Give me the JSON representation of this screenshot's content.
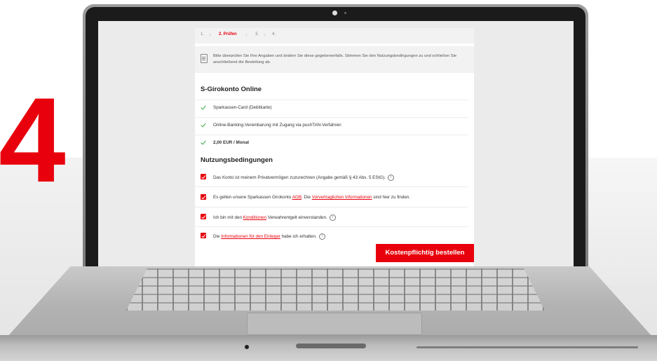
{
  "hero": {
    "step_number": "4"
  },
  "progress": {
    "steps": [
      {
        "label": "1.",
        "active": false
      },
      {
        "label": "2. Prüfen",
        "active": true
      },
      {
        "label": "3.",
        "active": false
      },
      {
        "label": "4.",
        "active": false
      }
    ]
  },
  "notice": {
    "icon": "document-icon",
    "text": "Bitte überprüfen Sie Ihre Angaben und ändern Sie diese gegebenenfalls. Stimmen Sie den Nutzungsbedingungen zu und schließen Sie anschließend die Bestellung ab."
  },
  "product": {
    "title": "S-Girokonto Online",
    "features": [
      "Sparkassen-Card (Debitkarte)",
      "Online-Banking-Vereinbarung mit Zugang via pushTAN-Verfahren",
      "2,00 EUR / Monat"
    ]
  },
  "terms": {
    "title": "Nutzungsbedingungen",
    "t1": "Das Konto ist meinem Privatvermögen zuzurechnen (Angabe gemäß § 43 Abs. 5 EStG).",
    "t2a": "Es gelten unsere Sparkassen Girokonto ",
    "t2_link1": "AGB",
    "t2b": ". Die ",
    "t2_link2": "Vorvertraglichen Informationen",
    "t2c": " sind hier zu finden.",
    "t3a": "Ich bin mit den ",
    "t3_link": "Konditionen",
    "t3b": " Verwahrentgelt einverstanden.",
    "t4a": "Die ",
    "t4_link": "Informationen für den Einleger",
    "t4b": " habe ich erhalten.",
    "info_icon": "i"
  },
  "order_button": "Kostenpflichtig bestellen",
  "colors": {
    "accent": "#e8000c",
    "check": "#3aa645"
  }
}
